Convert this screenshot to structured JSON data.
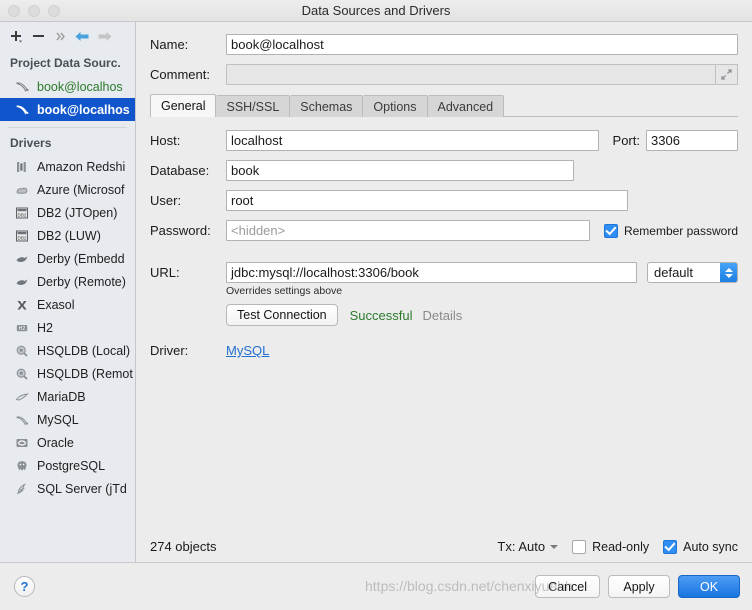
{
  "window": {
    "title": "Data Sources and Drivers",
    "traffic_lights": [
      "close",
      "minimize",
      "zoom"
    ]
  },
  "sidebar": {
    "toolbar": [
      {
        "name": "add-button",
        "glyph": "+"
      },
      {
        "name": "remove-button",
        "glyph": "−"
      },
      {
        "name": "more-button",
        "glyph": "»"
      },
      {
        "name": "back-button",
        "glyph": "←"
      },
      {
        "name": "forward-button",
        "glyph": "→"
      }
    ],
    "project_group_label": "Project Data Sourc.",
    "data_sources": [
      {
        "label": "book@localhos",
        "icon": "mysql-icon",
        "selected": false
      },
      {
        "label": "book@localhos",
        "icon": "mysql-icon",
        "selected": true
      }
    ],
    "drivers_group_label": "Drivers",
    "drivers": [
      {
        "label": "Amazon Redshi",
        "icon": "redshift-icon"
      },
      {
        "label": "Azure (Microsof",
        "icon": "azure-icon"
      },
      {
        "label": "DB2 (JTOpen)",
        "icon": "db2-icon"
      },
      {
        "label": "DB2 (LUW)",
        "icon": "db2-icon"
      },
      {
        "label": "Derby (Embedd",
        "icon": "derby-icon"
      },
      {
        "label": "Derby (Remote)",
        "icon": "derby-icon"
      },
      {
        "label": "Exasol",
        "icon": "exasol-icon"
      },
      {
        "label": "H2",
        "icon": "h2-icon"
      },
      {
        "label": "HSQLDB (Local)",
        "icon": "hsqldb-icon"
      },
      {
        "label": "HSQLDB (Remot",
        "icon": "hsqldb-icon"
      },
      {
        "label": "MariaDB",
        "icon": "mariadb-icon"
      },
      {
        "label": "MySQL",
        "icon": "mysql-icon"
      },
      {
        "label": "Oracle",
        "icon": "oracle-icon"
      },
      {
        "label": "PostgreSQL",
        "icon": "postgresql-icon"
      },
      {
        "label": "SQL Server (jTd",
        "icon": "sqlserver-icon"
      }
    ]
  },
  "form": {
    "name_label": "Name:",
    "name_value": "book@localhost",
    "comment_label": "Comment:",
    "comment_value": "",
    "comment_placeholder": ""
  },
  "tabs": [
    {
      "label": "General",
      "active": true
    },
    {
      "label": "SSH/SSL",
      "active": false
    },
    {
      "label": "Schemas",
      "active": false
    },
    {
      "label": "Options",
      "active": false
    },
    {
      "label": "Advanced",
      "active": false
    }
  ],
  "general": {
    "host_label": "Host:",
    "host_value": "localhost",
    "port_label": "Port:",
    "port_value": "3306",
    "database_label": "Database:",
    "database_value": "book",
    "user_label": "User:",
    "user_value": "root",
    "password_label": "Password:",
    "password_placeholder": "<hidden>",
    "remember_password_label": "Remember password",
    "remember_password_checked": true,
    "url_label": "URL:",
    "url_value": "jdbc:mysql://localhost:3306/book",
    "url_mode_value": "default",
    "overrides_note": "Overrides settings above",
    "test_connection_label": "Test Connection",
    "test_status": "Successful",
    "test_details_label": "Details",
    "driver_label": "Driver:",
    "driver_value": "MySQL"
  },
  "status_bar": {
    "objects_count": "274 objects",
    "tx_label": "Tx: Auto",
    "read_only_label": "Read-only",
    "read_only_checked": false,
    "auto_sync_label": "Auto sync",
    "auto_sync_checked": true
  },
  "footer": {
    "help_glyph": "?",
    "cancel_label": "Cancel",
    "apply_label": "Apply",
    "ok_label": "OK"
  },
  "watermark": "https://blog.csdn.net/chenxiyuehh",
  "colors": {
    "selection_blue": "#1155cc",
    "accent_blue": "#2f8ef4",
    "success_green": "#2b7a2b",
    "link_blue": "#1f6fd0",
    "datasource_green": "#2d7a2d",
    "window_bg": "#ececec",
    "sidebar_bg": "#e7eaee"
  }
}
